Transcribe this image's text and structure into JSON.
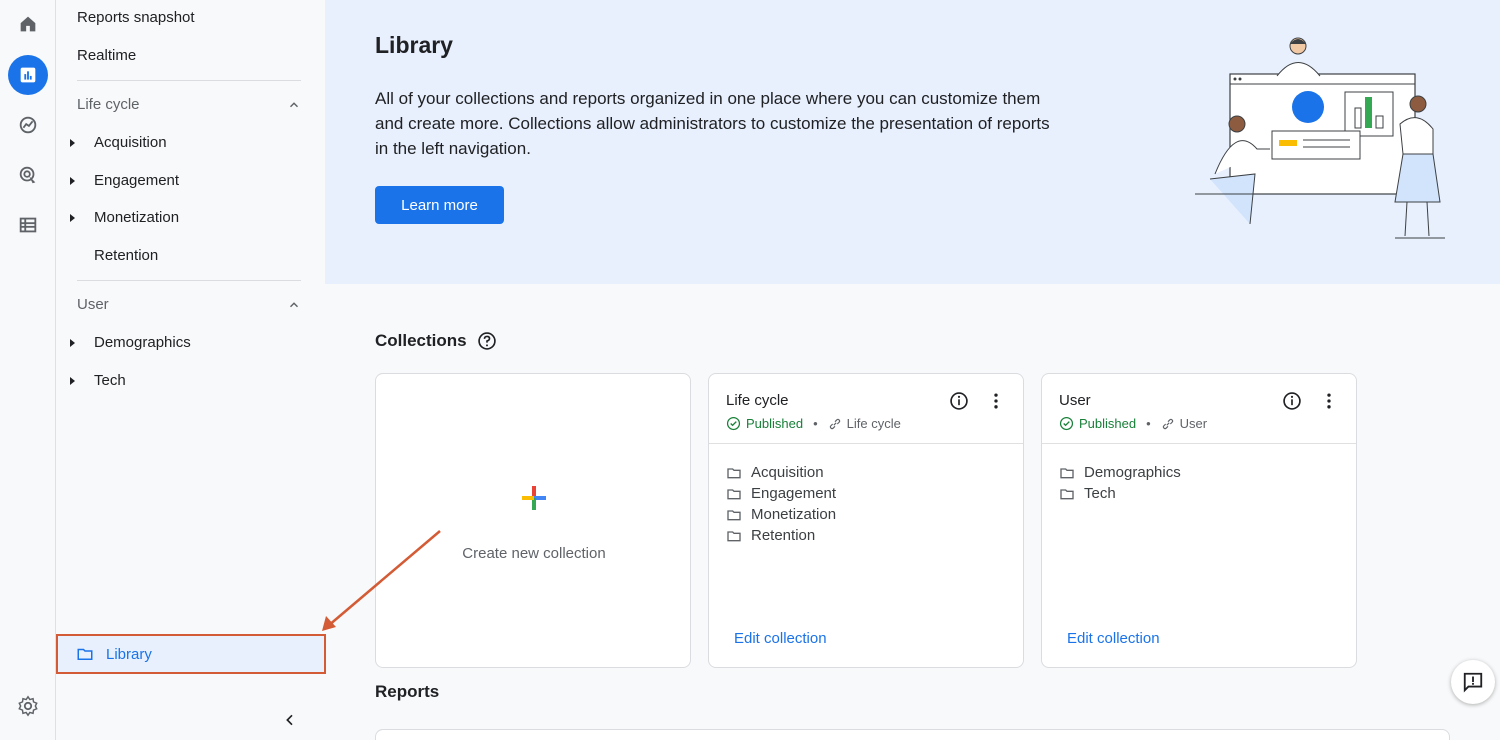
{
  "sidebar": {
    "top_items": [
      "Reports snapshot",
      "Realtime"
    ],
    "sections": [
      {
        "label": "Life cycle",
        "items": [
          "Acquisition",
          "Engagement",
          "Monetization",
          "Retention"
        ]
      },
      {
        "label": "User",
        "items": [
          "Demographics",
          "Tech"
        ]
      }
    ],
    "library_label": "Library"
  },
  "hero": {
    "title": "Library",
    "description": "All of your collections and reports organized in one place where you can customize them and create more. Collections allow administrators to customize the presentation of reports in the left navigation.",
    "button_label": "Learn more"
  },
  "collections": {
    "title": "Collections",
    "create_label": "Create new collection",
    "cards": [
      {
        "title": "Life cycle",
        "status": "Published",
        "tag": "Life cycle",
        "folders": [
          "Acquisition",
          "Engagement",
          "Monetization",
          "Retention"
        ],
        "edit_label": "Edit collection"
      },
      {
        "title": "User",
        "status": "Published",
        "tag": "User",
        "folders": [
          "Demographics",
          "Tech"
        ],
        "edit_label": "Edit collection"
      }
    ]
  },
  "reports": {
    "title": "Reports"
  },
  "colors": {
    "accent": "#1a73e8",
    "published": "#188038",
    "annotation": "#d35b35"
  }
}
